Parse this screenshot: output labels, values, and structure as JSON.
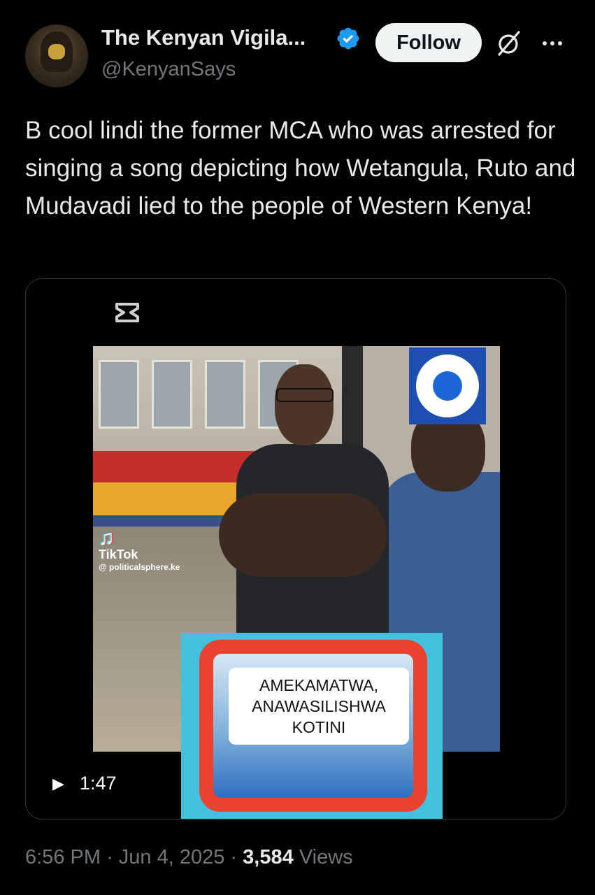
{
  "author": {
    "name": "The Kenyan Vigila...",
    "handle": "@KenyanSays",
    "verified_color": "#1d9bf0"
  },
  "actions": {
    "follow_label": "Follow",
    "grok_icon": "grok-icon",
    "more_icon": "more-icon"
  },
  "tweet": {
    "text": "B cool lindi the former MCA who was arrested for singing a song depicting how Wetangula, Ruto and Mudavadi lied to the people of Western Kenya!"
  },
  "media": {
    "tiktok_brand": "TikTok",
    "tiktok_account": "@ politicalsphere.ke",
    "caption_lines": [
      "AMEKAMATWA,",
      "ANAWASILISHWA",
      "KOTINI"
    ],
    "duration": "1:47"
  },
  "meta": {
    "time": "6:56 PM",
    "separator": "·",
    "date": "Jun 4, 2025",
    "views_count": "3,584",
    "views_label": "Views"
  }
}
